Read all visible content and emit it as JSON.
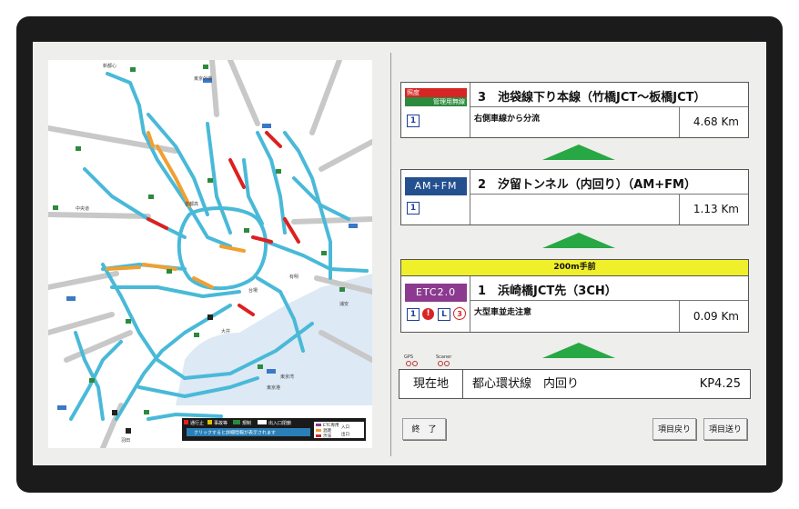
{
  "map": {
    "labels": [
      "新都心",
      "東京外環",
      "中央道",
      "東京湾",
      "首都高",
      "羽田",
      "大井",
      "東京港",
      "台場",
      "有明",
      "浦安"
    ],
    "legend": {
      "items": [
        "通行止",
        "事故等",
        "規制",
        "出入口閉鎖",
        "ETC専用",
        "渋滞",
        "混雑"
      ],
      "note": "クリックすると詳細情報が表示されます",
      "entrance": "入口",
      "exit": "出口"
    }
  },
  "cards": [
    {
      "badge": "照度管理用無線",
      "badge_top": "照度",
      "badge_bottom": "管理用無線",
      "title": "3　池袋線下り本線（竹橋JCT～板橋JCT）",
      "sub": "右側車線から分流",
      "dist": "4.68 Km",
      "lanes": [
        "1"
      ]
    },
    {
      "badge": "AM+FM",
      "title": "2　汐留トンネル（内回り）（AM+FM）",
      "sub": "",
      "dist": "1.13 Km",
      "lanes": [
        "1"
      ]
    },
    {
      "badge": "ETC2.0",
      "header": "200m手前",
      "title": "1　浜崎橋JCT先（3CH）",
      "sub": "大型車並走注意",
      "dist": "0.09 Km",
      "lanes": [
        "1",
        "!",
        "L",
        "3"
      ]
    }
  ],
  "status": {
    "gps_label": "GPS",
    "scanner_label": "Scaner"
  },
  "current": {
    "label": "現在地",
    "road": "都心環状線　内回り",
    "kp": "KP4.25"
  },
  "buttons": {
    "exit": "終　了",
    "prev": "項目戻り",
    "next": "項目送り"
  },
  "colors": {
    "arrow": "#28a745",
    "header": "#f0f02a",
    "etc": "#8b3a8f",
    "amfm": "#24508f",
    "lighting_top": "#d62525",
    "lighting_bottom": "#2c8a3d"
  }
}
